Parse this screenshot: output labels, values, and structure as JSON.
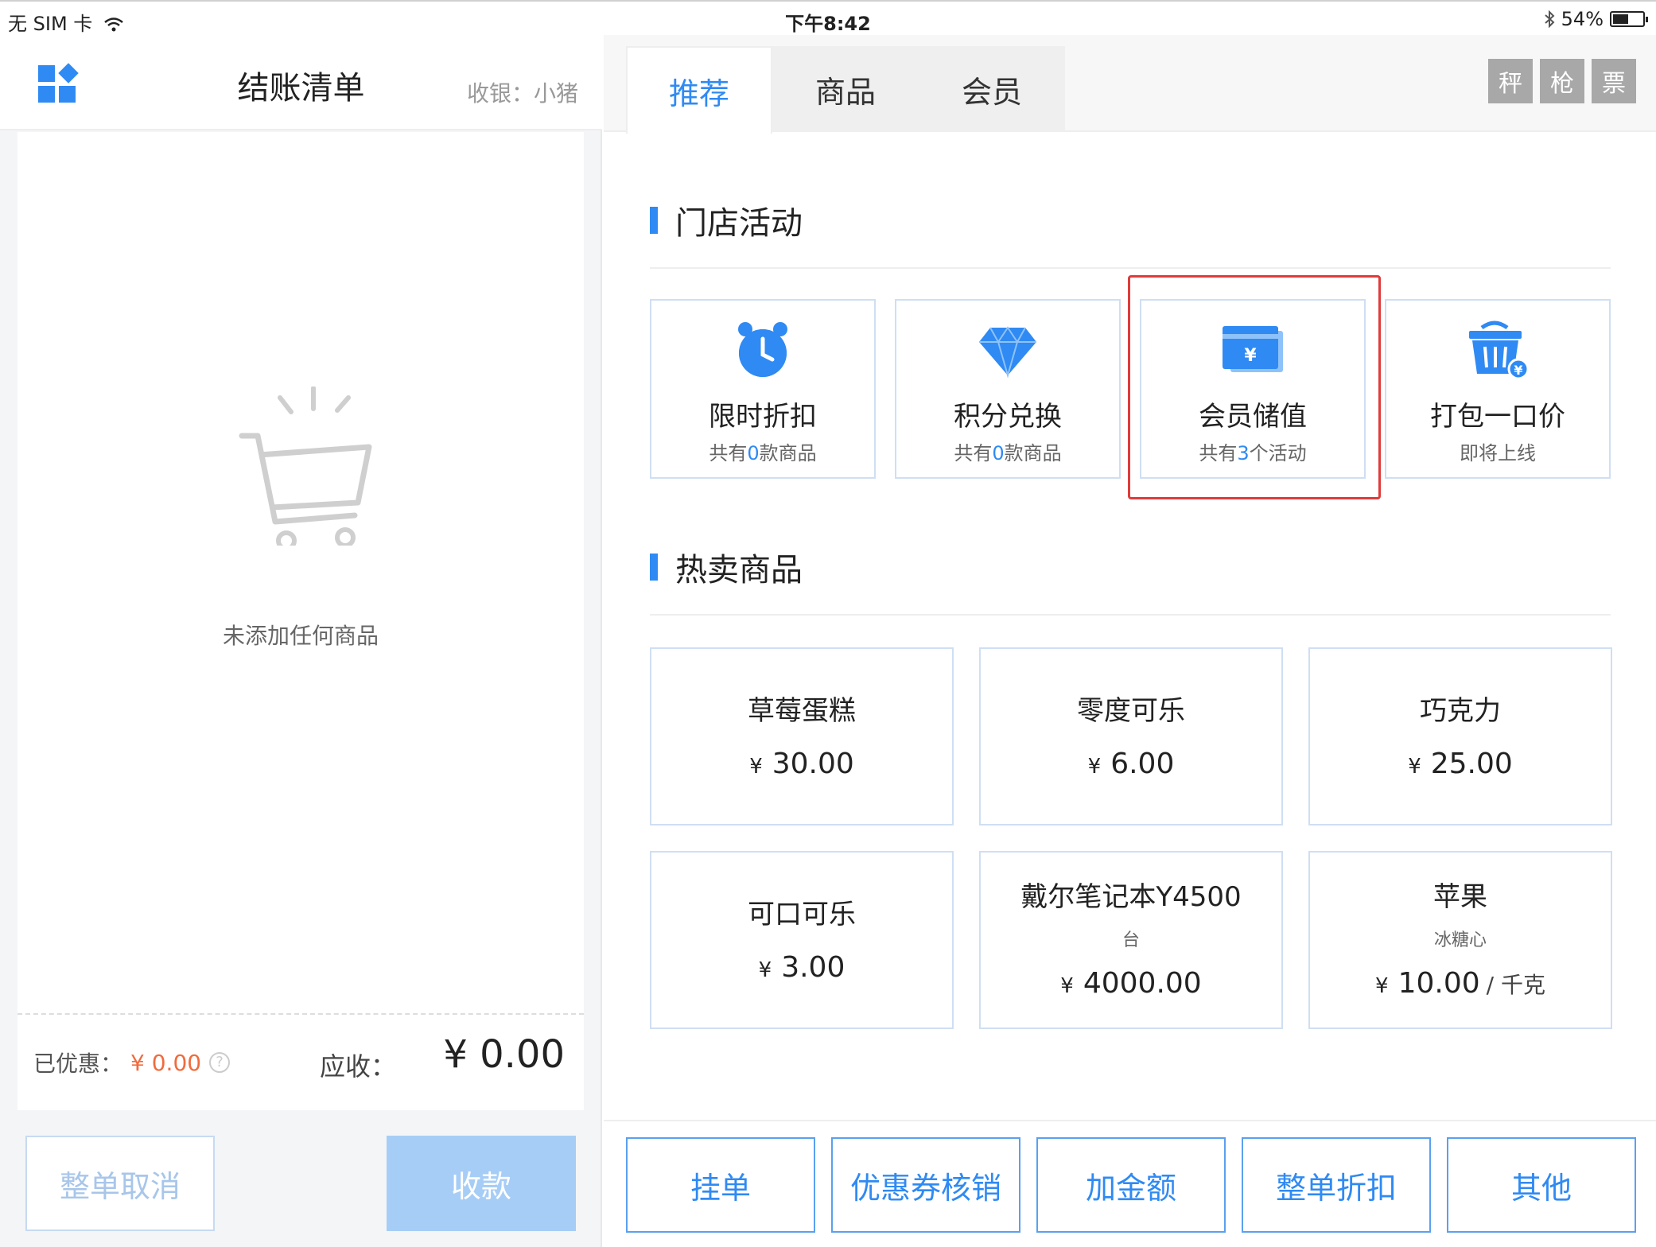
{
  "status_bar": {
    "carrier": "无 SIM 卡",
    "time": "下午8:42",
    "battery": "54%",
    "battery_level": 0.54
  },
  "left_panel": {
    "title": "结账清单",
    "cashier": "收银：小猪",
    "empty_text": "未添加任何商品",
    "discount_label": "已优惠：",
    "discount_value": "¥ 0.00",
    "due_label": "应收：",
    "due_value": "¥ 0.00",
    "cancel_button": "整单取消",
    "pay_button": "收款"
  },
  "tabs": [
    {
      "label": "推荐",
      "active": true
    },
    {
      "label": "商品",
      "active": false
    },
    {
      "label": "会员",
      "active": false
    }
  ],
  "tools": [
    "秤",
    "枪",
    "票"
  ],
  "activities_section": {
    "title": "门店活动",
    "items": [
      {
        "icon": "alarm-clock-icon",
        "name": "限时折扣",
        "sub_prefix": "共有",
        "sub_num": "0",
        "sub_suffix": "款商品"
      },
      {
        "icon": "diamond-icon",
        "name": "积分兑换",
        "sub_prefix": "共有",
        "sub_num": "0",
        "sub_suffix": "款商品"
      },
      {
        "icon": "wallet-card-icon",
        "name": "会员储值",
        "sub_prefix": "共有",
        "sub_num": "3",
        "sub_suffix": "个活动"
      },
      {
        "icon": "basket-icon",
        "name": "打包一口价",
        "sub_prefix": "即将上线",
        "sub_num": "",
        "sub_suffix": ""
      }
    ]
  },
  "hot_section": {
    "title": "热卖商品",
    "items": [
      {
        "name": "草莓蛋糕",
        "unit": "",
        "price": "30.00",
        "per": ""
      },
      {
        "name": "零度可乐",
        "unit": "",
        "price": "6.00",
        "per": ""
      },
      {
        "name": "巧克力",
        "unit": "",
        "price": "25.00",
        "per": ""
      },
      {
        "name": "可口可乐",
        "unit": "",
        "price": "3.00",
        "per": ""
      },
      {
        "name": "戴尔笔记本Y4500",
        "unit": "台",
        "price": "4000.00",
        "per": ""
      },
      {
        "name": "苹果",
        "unit": "冰糖心",
        "price": "10.00",
        "per": "/ 千克"
      }
    ],
    "currency": "¥"
  },
  "bottom_actions": [
    "挂单",
    "优惠券核销",
    "加金额",
    "整单折扣",
    "其他"
  ],
  "colors": {
    "accent": "#2f8af3",
    "discount": "#f06b3d",
    "highlight": "#e03b3b"
  }
}
